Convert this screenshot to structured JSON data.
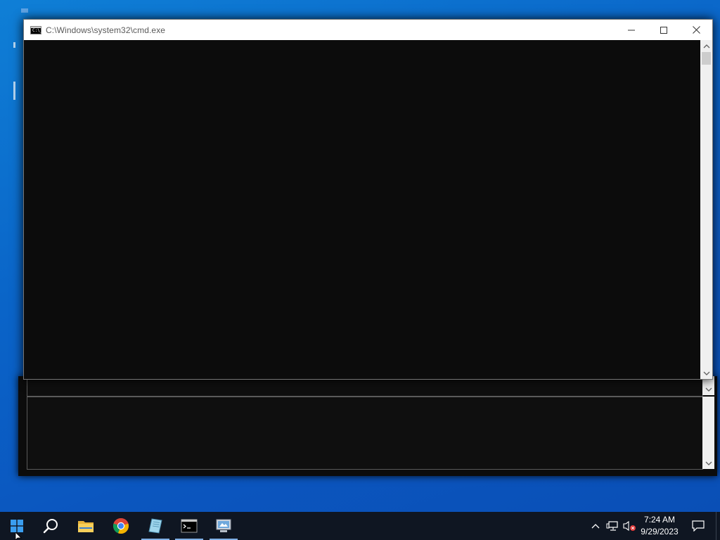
{
  "window": {
    "title": "C:\\Windows\\system32\\cmd.exe",
    "icon_label": "C:\\_",
    "icon": "console-icon",
    "console_text": ""
  },
  "titlebar_buttons": {
    "minimize": "minimize-icon",
    "maximize": "maximize-icon",
    "close": "close-icon"
  },
  "taskbar": {
    "apps": [
      {
        "name": "start-button",
        "icon": "windows-logo-icon"
      },
      {
        "name": "search-button",
        "icon": "search-icon"
      },
      {
        "name": "file-explorer",
        "icon": "folder-icon"
      },
      {
        "name": "chrome",
        "icon": "chrome-icon"
      },
      {
        "name": "app-launcher",
        "icon": "notepad-book-icon"
      },
      {
        "name": "command-prompt",
        "icon": "console-icon"
      },
      {
        "name": "control-panel",
        "icon": "computer-icon"
      }
    ],
    "tray": {
      "overflow": "chevron-up-icon",
      "network": "network-icon",
      "volume": "volume-muted-icon",
      "notifications": "notification-icon"
    },
    "clock": {
      "time": "7:24 AM",
      "date": "9/29/2023"
    }
  },
  "colors": {
    "taskbar": "#0f1622",
    "console_bg": "#0c0c0c",
    "titlebar": "#ffffff",
    "wallpaper": "#0a64c8"
  }
}
